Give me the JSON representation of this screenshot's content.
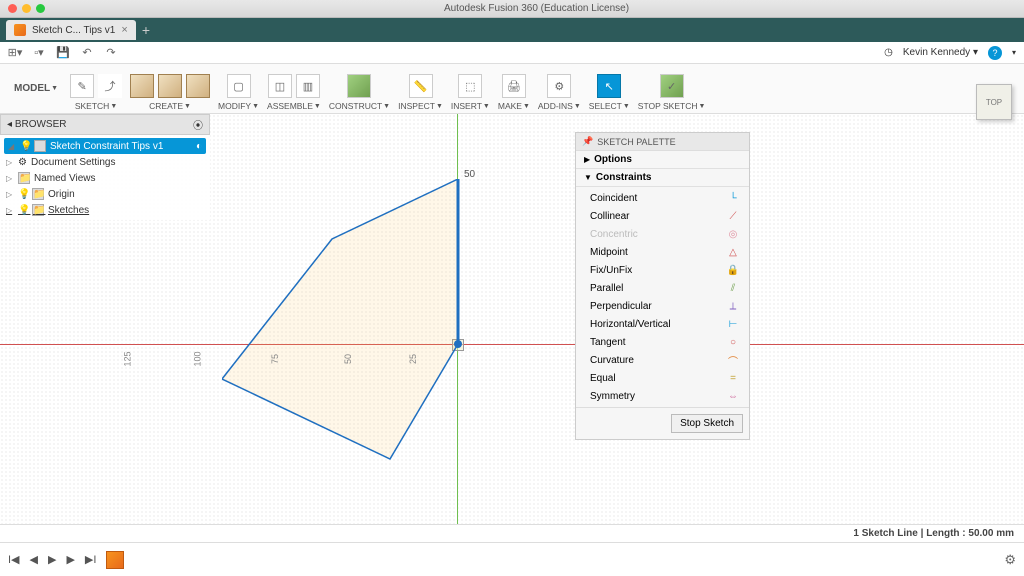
{
  "titlebar": {
    "title": "Autodesk Fusion 360 (Education License)"
  },
  "tab": {
    "name": "Sketch C... Tips v1",
    "close": "×"
  },
  "quickbar": {
    "user": "Kevin Kennedy"
  },
  "ribbon": {
    "model": "MODEL",
    "groups": [
      {
        "label": "SKETCH"
      },
      {
        "label": "CREATE"
      },
      {
        "label": "MODIFY"
      },
      {
        "label": "ASSEMBLE"
      },
      {
        "label": "CONSTRUCT"
      },
      {
        "label": "INSPECT"
      },
      {
        "label": "INSERT"
      },
      {
        "label": "MAKE"
      },
      {
        "label": "ADD-INS"
      },
      {
        "label": "SELECT"
      },
      {
        "label": "STOP SKETCH"
      }
    ]
  },
  "browser": {
    "title": "BROWSER",
    "root": "Sketch Constraint Tips v1",
    "items": [
      {
        "label": "Document Settings"
      },
      {
        "label": "Named Views"
      },
      {
        "label": "Origin"
      },
      {
        "label": "Sketches"
      }
    ]
  },
  "palette": {
    "title": "SKETCH PALETTE",
    "options": "Options",
    "constraints_hdr": "Constraints",
    "constraints": [
      {
        "label": "Coincident",
        "glyph": "└",
        "color": "#0696d7"
      },
      {
        "label": "Collinear",
        "glyph": "⟋",
        "color": "#d05050"
      },
      {
        "label": "Concentric",
        "glyph": "◎",
        "color": "#e090a0",
        "disabled": true
      },
      {
        "label": "Midpoint",
        "glyph": "△",
        "color": "#d05050"
      },
      {
        "label": "Fix/UnFix",
        "glyph": "🔒",
        "color": "#e08030"
      },
      {
        "label": "Parallel",
        "glyph": "⫽",
        "color": "#70a050"
      },
      {
        "label": "Perpendicular",
        "glyph": "⟂",
        "color": "#8060c0"
      },
      {
        "label": "Horizontal/Vertical",
        "glyph": "⊢",
        "color": "#0696d7"
      },
      {
        "label": "Tangent",
        "glyph": "○",
        "color": "#d05050"
      },
      {
        "label": "Curvature",
        "glyph": "⌒",
        "color": "#e08030"
      },
      {
        "label": "Equal",
        "glyph": "=",
        "color": "#c0a030"
      },
      {
        "label": "Symmetry",
        "glyph": "⇔",
        "color": "#d070a0"
      }
    ],
    "stop": "Stop Sketch"
  },
  "viewcube": {
    "face": "TOP"
  },
  "canvas": {
    "dim50": "50",
    "rulers": {
      "r125": "125",
      "r100": "100",
      "r75": "75",
      "r50": "50",
      "r25": "25"
    }
  },
  "status": {
    "info": "1 Sketch Line | Length : 50.00 mm"
  }
}
